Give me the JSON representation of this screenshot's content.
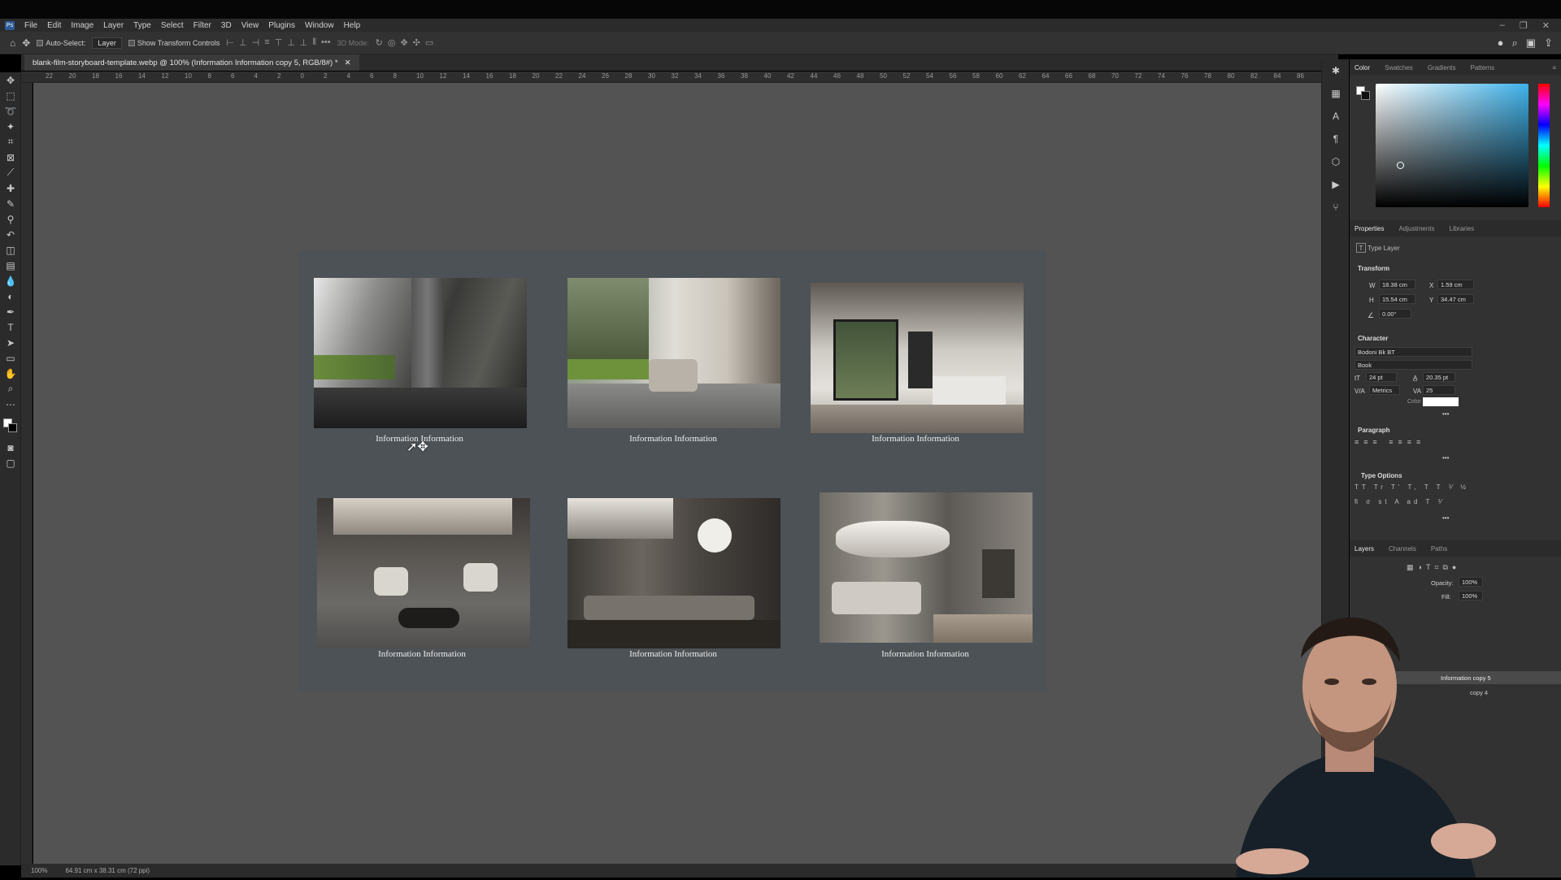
{
  "app": {
    "menu": [
      "File",
      "Edit",
      "Image",
      "Layer",
      "Type",
      "Select",
      "Filter",
      "3D",
      "View",
      "Plugins",
      "Window",
      "Help"
    ],
    "logo": "Ps"
  },
  "options_bar": {
    "auto_select_label": "Auto-Select:",
    "auto_select_value": "Layer",
    "show_transform_label": "Show Transform Controls",
    "mode_3d_label": "3D Mode:"
  },
  "document": {
    "tab_title": "blank-film-storyboard-template.webp @ 100% (Information Information copy 5, RGB/8#) *",
    "ruler_labels": [
      "22",
      "20",
      "18",
      "16",
      "14",
      "12",
      "10",
      "8",
      "6",
      "4",
      "2",
      "0",
      "2",
      "4",
      "6",
      "8",
      "10",
      "12",
      "14",
      "16",
      "18",
      "20",
      "22",
      "24",
      "26",
      "28",
      "30",
      "32",
      "34",
      "36",
      "38",
      "40",
      "42",
      "44",
      "46",
      "48",
      "50",
      "52",
      "54",
      "56",
      "58",
      "60",
      "62",
      "64",
      "66",
      "68",
      "70",
      "72",
      "74",
      "76",
      "78",
      "80",
      "82",
      "84",
      "86"
    ]
  },
  "storyboard": {
    "captions": [
      "Information Information",
      "Information Information",
      "Information Information",
      "Information Information",
      "Information Information",
      "Information Information"
    ]
  },
  "status": {
    "zoom": "100%",
    "doc_size": "64.91 cm x 38.31 cm (72 ppi)"
  },
  "color_panel": {
    "tabs": [
      "Color",
      "Swatches",
      "Gradients",
      "Patterns"
    ],
    "spectrum_colors": [
      "#ff0000",
      "#ffff00",
      "#00ff00",
      "#00ffff",
      "#0000ff",
      "#ff00ff",
      "#ff0000"
    ],
    "field_hue": "#3fb2ea"
  },
  "properties": {
    "tabs": [
      "Properties",
      "Adjustments",
      "Libraries"
    ],
    "layer_kind": "Type Layer",
    "transform_title": "Transform",
    "w_label": "W",
    "w_value": "18.38 cm",
    "x_label": "X",
    "x_value": "1.59 cm",
    "h_label": "H",
    "h_value": "15.54 cm",
    "y_label": "Y",
    "y_value": "34.47 cm",
    "angle_value": "0.00°",
    "character_title": "Character",
    "font_family": "Bodoni Bk BT",
    "font_style": "Book",
    "font_size": "24 pt",
    "leading": "20.35 pt",
    "kerning": "Metrics",
    "tracking": "25",
    "color_label": "Color",
    "paragraph_title": "Paragraph",
    "type_options_title": "Type Options"
  },
  "layers": {
    "tabs": [
      "Layers",
      "Channels",
      "Paths"
    ],
    "opacity_label": "Opacity:",
    "opacity_value": "100%",
    "fill_label": "Fill:",
    "fill_value": "100%",
    "selected_layer": "Information copy 5",
    "next_layer": "copy 4"
  }
}
